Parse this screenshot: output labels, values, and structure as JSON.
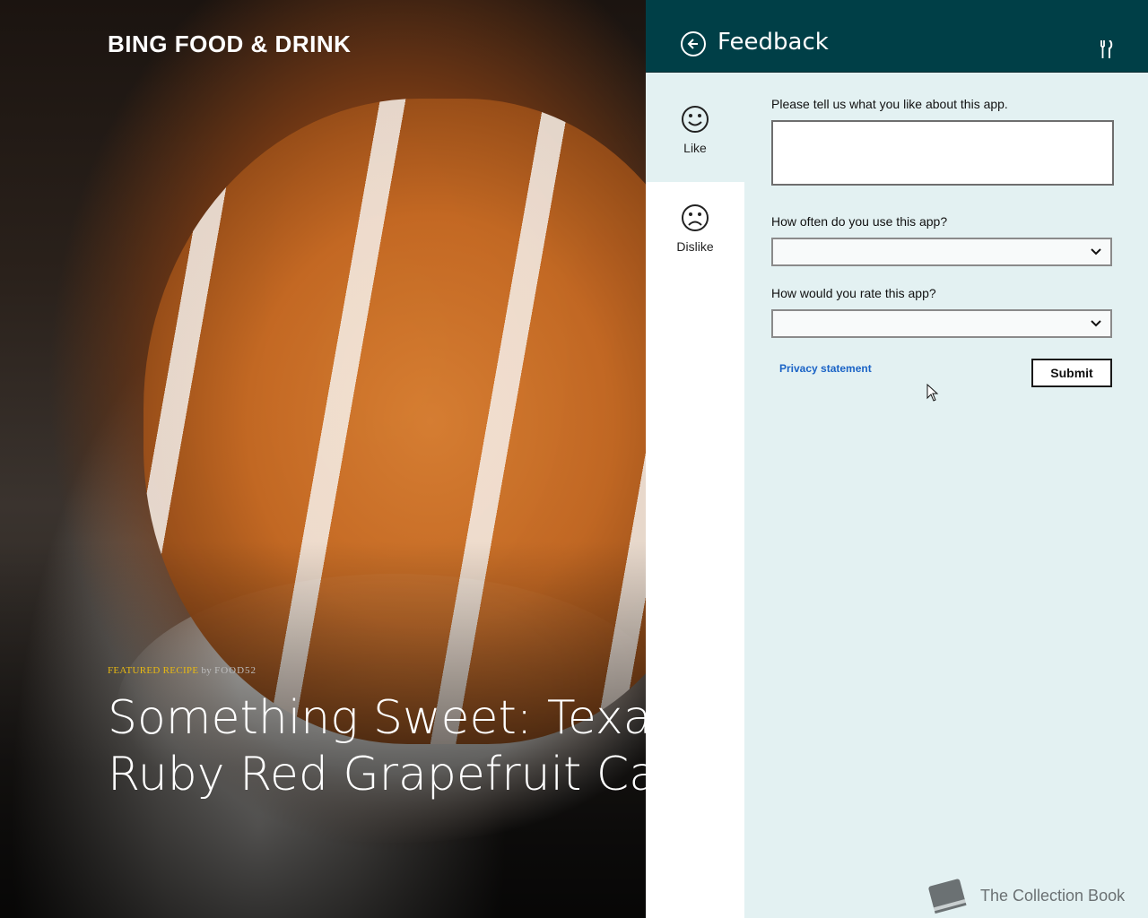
{
  "app": {
    "title": "BING FOOD & DRINK"
  },
  "hero": {
    "featured_tag": "FEATURED RECIPE",
    "by": "by",
    "source": "FOOD52",
    "headline_line1": "Something Sweet: Texas",
    "headline_line2": "Ruby Red Grapefruit Cake"
  },
  "flyout": {
    "title": "Feedback",
    "header_icon": "utensils-icon",
    "rail": [
      {
        "label": "Like",
        "icon": "smiley-icon",
        "active": true
      },
      {
        "label": "Dislike",
        "icon": "frown-icon",
        "active": false
      }
    ],
    "question_like": "Please tell us what you like about this app.",
    "like_value": "",
    "question_frequency": "How often do you use this app?",
    "frequency_value": "",
    "question_rating": "How would you rate this app?",
    "rating_value": "",
    "privacy_link": "Privacy statement",
    "submit_label": "Submit"
  },
  "watermark": {
    "text": "The Collection Book",
    "icon": "book-icon"
  },
  "colors": {
    "header_bg": "#003f47",
    "panel_bg": "#e3f1f2",
    "link": "#1a63c6",
    "featured_tag": "#e8b912"
  }
}
